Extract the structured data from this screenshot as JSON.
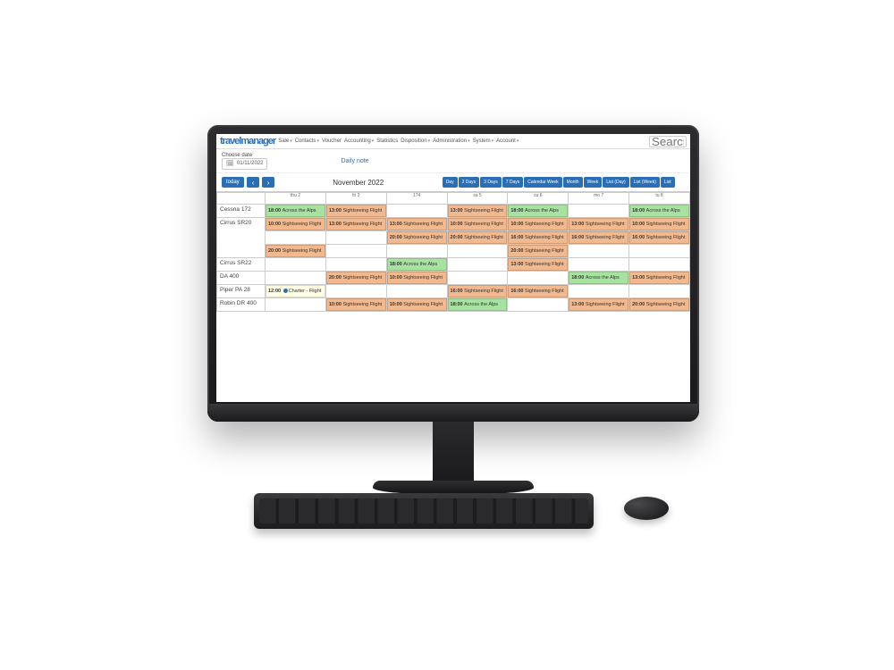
{
  "brand": "travelmanager",
  "nav": {
    "sale": "Sale",
    "contacts": "Contacts",
    "voucher": "Voucher",
    "accounting": "Accounting",
    "statistics": "Statistics",
    "disposition": "Disposition",
    "administration": "Administration",
    "system": "System",
    "account": "Account"
  },
  "search_placeholder": "Search",
  "toolbar": {
    "choose_date_label": "Choose date",
    "date_value": "01/11/2022",
    "daily_note": "Daily note"
  },
  "calnav": {
    "today": "today",
    "prev": "‹",
    "next": "›",
    "title": "November 2022"
  },
  "views": {
    "day": "Day",
    "d2": "2 Days",
    "d3": "3 Days",
    "d7": "7 Days",
    "cw": "Calendar Week",
    "month": "Month",
    "week": "Week",
    "listday": "List (Day)",
    "listweek": "List (Week)",
    "list": "List"
  },
  "day_headers": [
    "thu 2",
    "fri 3",
    "174",
    "sa 5",
    "su 6",
    "mo 7",
    "tu 8"
  ],
  "resources": [
    "Cessna 172",
    "Cirrus SR20",
    "Cirrus SR22",
    "DA 400",
    "Piper PA 28",
    "Robin DR 400"
  ],
  "schedule": [
    {
      "res": 0,
      "rows": [
        [
          {
            "day": 0,
            "kind": "green",
            "t": "18:00",
            "txt": "Across the Alps"
          },
          {
            "day": 1,
            "kind": "orange",
            "t": "13:00",
            "txt": "Sightseeing Flight"
          },
          {
            "day": 3,
            "kind": "orange",
            "t": "13:00",
            "txt": "Sightseeing Flight"
          },
          {
            "day": 4,
            "kind": "green",
            "t": "18:00",
            "txt": "Across the Alps"
          },
          {
            "day": 6,
            "kind": "green",
            "t": "18:00",
            "txt": "Across the Alps"
          }
        ]
      ]
    },
    {
      "res": 1,
      "rows": [
        [
          {
            "day": 0,
            "kind": "orange",
            "t": "10:00",
            "txt": "Sightseeing Flight"
          },
          {
            "day": 1,
            "kind": "orange",
            "t": "13:00",
            "txt": "Sightseeing Flight"
          },
          {
            "day": 2,
            "kind": "orange",
            "t": "13:00",
            "txt": "Sightseeing Flight"
          },
          {
            "day": 3,
            "kind": "orange",
            "t": "10:00",
            "txt": "Sightseeing Flight"
          },
          {
            "day": 4,
            "kind": "orange",
            "t": "10:00",
            "txt": "Sightseeing Flight"
          },
          {
            "day": 5,
            "kind": "orange",
            "t": "13:00",
            "txt": "Sightseeing Flight"
          },
          {
            "day": 6,
            "kind": "orange",
            "t": "10:00",
            "txt": "Sightseeing Flight"
          }
        ],
        [
          {
            "day": 2,
            "kind": "orange",
            "t": "20:00",
            "txt": "Sightseeing Flight"
          },
          {
            "day": 3,
            "kind": "orange",
            "t": "20:00",
            "txt": "Sightseeing Flight"
          },
          {
            "day": 4,
            "kind": "orange",
            "t": "16:00",
            "txt": "Sightseeing Flight"
          },
          {
            "day": 5,
            "kind": "orange",
            "t": "16:00",
            "txt": "Sightseeing Flight"
          },
          {
            "day": 6,
            "kind": "orange",
            "t": "16:00",
            "txt": "Sightseeing Flight"
          }
        ],
        [
          {
            "day": 0,
            "kind": "orange",
            "t": "20:00",
            "txt": "Sightseeing Flight"
          },
          {
            "day": 4,
            "kind": "orange",
            "t": "20:00",
            "txt": "Sightseeing Flight"
          }
        ]
      ]
    },
    {
      "res": 2,
      "rows": [
        [
          {
            "day": 2,
            "kind": "green",
            "t": "18:00",
            "txt": "Across the Alps"
          },
          {
            "day": 4,
            "kind": "orange",
            "t": "13:00",
            "txt": "Sightseeing Flight"
          }
        ]
      ]
    },
    {
      "res": 3,
      "rows": [
        [
          {
            "day": 1,
            "kind": "orange",
            "t": "20:00",
            "txt": "Sightseeing Flight"
          },
          {
            "day": 2,
            "kind": "orange",
            "t": "10:00",
            "txt": "Sightseeing Flight"
          },
          {
            "day": 5,
            "kind": "green",
            "t": "18:00",
            "txt": "Across the Alps"
          },
          {
            "day": 6,
            "kind": "orange",
            "t": "13:00",
            "txt": "Sightseeing Flight"
          }
        ]
      ]
    },
    {
      "res": 4,
      "rows": [
        [
          {
            "day": 0,
            "kind": "yellowish",
            "t": "12:00",
            "txt": "Charter - Flight",
            "dot": true
          },
          {
            "day": 3,
            "kind": "orange",
            "t": "16:00",
            "txt": "Sightseeing Flight"
          },
          {
            "day": 4,
            "kind": "orange",
            "t": "16:00",
            "txt": "Sightseeing Flight"
          }
        ]
      ]
    },
    {
      "res": 5,
      "rows": [
        [
          {
            "day": 1,
            "kind": "orange",
            "t": "10:00",
            "txt": "Sightseeing Flight"
          },
          {
            "day": 2,
            "kind": "orange",
            "t": "10:00",
            "txt": "Sightseeing Flight"
          },
          {
            "day": 3,
            "kind": "green",
            "t": "18:00",
            "txt": "Across the Alps"
          },
          {
            "day": 5,
            "kind": "orange",
            "t": "13:00",
            "txt": "Sightseeing Flight"
          },
          {
            "day": 6,
            "kind": "orange",
            "t": "20:00",
            "txt": "Sightseeing Flight"
          }
        ]
      ]
    }
  ]
}
